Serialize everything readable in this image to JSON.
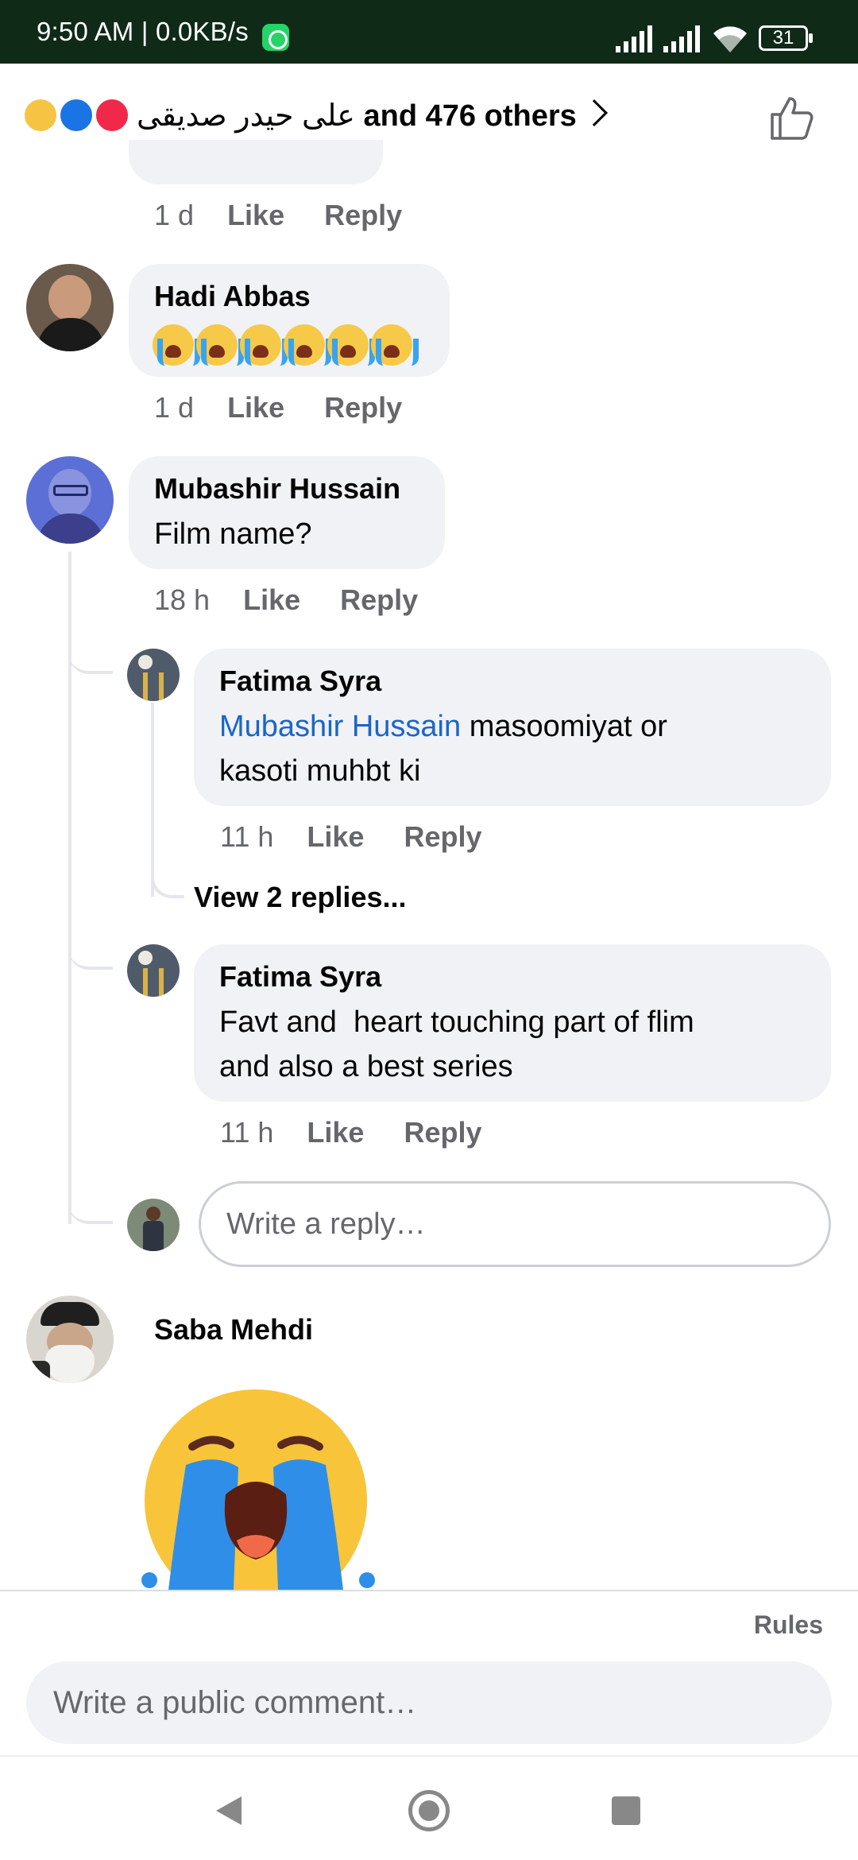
{
  "status_bar": {
    "time": "9:50 AM | 0.0KB/s",
    "battery": "31",
    "icons": [
      "whatsapp-icon",
      "signal-icon",
      "signal-icon",
      "wifi-icon",
      "battery-icon"
    ]
  },
  "reactions": {
    "names": "علی حیدر صدیقی",
    "others": "and 476 others",
    "icons": [
      "sad-reaction-icon",
      "like-reaction-icon",
      "love-reaction-icon",
      "chevron-right-icon",
      "thumbs-up-icon"
    ]
  },
  "comments": [
    {
      "id": "prev",
      "time": "1 d",
      "like": "Like",
      "reply": "Reply"
    },
    {
      "id": "hadi",
      "name": "Hadi Abbas",
      "body_emoji_count": 6,
      "time": "1 d",
      "like": "Like",
      "reply": "Reply"
    },
    {
      "id": "mubashir",
      "name": "Mubashir Hussain",
      "body": "Film name?",
      "time": "18 h",
      "like": "Like",
      "reply": "Reply"
    },
    {
      "id": "saba",
      "name": "Saba Mehdi"
    }
  ],
  "replies": [
    {
      "name": "Fatima Syra",
      "mention": "Mubashir Hussain",
      "body_line1": " masoomiyat or",
      "body_line2": "kasoti muhbt ki",
      "time": "11 h",
      "like": "Like",
      "reply": "Reply",
      "view_replies": "View 2 replies..."
    },
    {
      "name": "Fatima Syra",
      "body_line1": "Favt and  heart touching part of flim",
      "body_line2": "and also a best series",
      "time": "11 h",
      "like": "Like",
      "reply": "Reply"
    }
  ],
  "reply_input": {
    "placeholder": "Write a reply…"
  },
  "footer": {
    "rules": "Rules",
    "comment_placeholder": "Write a public comment…"
  },
  "nav": {
    "icons": [
      "back-icon",
      "home-icon",
      "recents-icon"
    ]
  }
}
